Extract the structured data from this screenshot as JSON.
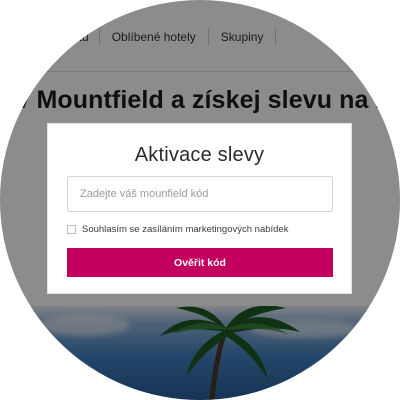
{
  "nav": {
    "items": [
      {
        "label": "...vení účtu"
      },
      {
        "label": "Oblíbené hotely"
      },
      {
        "label": "Skupiny"
      }
    ]
  },
  "headline": "o v Mountfield a získej slevu na z",
  "modal": {
    "title": "Aktivace slevy",
    "code_input": {
      "placeholder": "Zadejte váš mounfield kód",
      "value": ""
    },
    "consent": {
      "label": "Souhlasím se zasíláním marketingových nabídek",
      "checked": false
    },
    "submit_label": "Ověřit kód"
  },
  "colors": {
    "accent": "#c4005f",
    "overlay": "rgba(0,0,0,0.45)"
  }
}
